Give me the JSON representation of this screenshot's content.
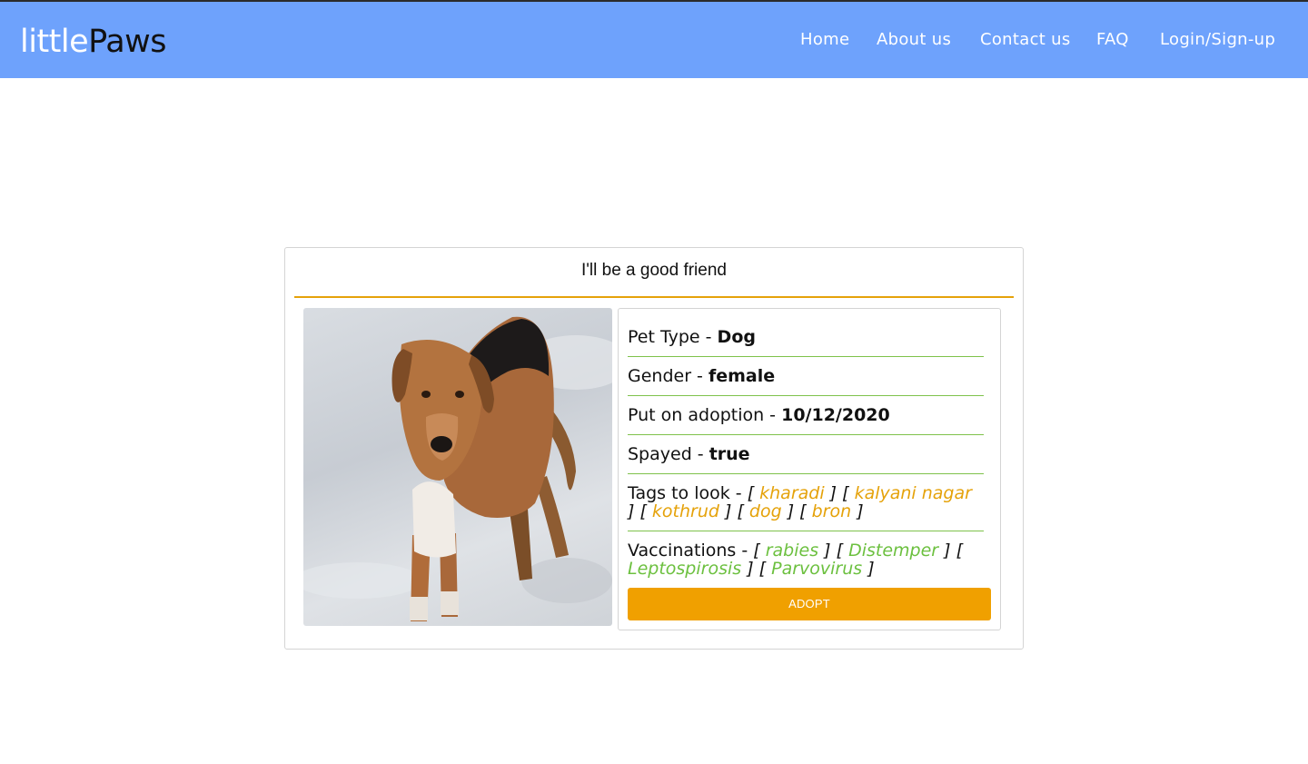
{
  "brand": {
    "light": "little",
    "dark": "Paws"
  },
  "nav": {
    "home": "Home",
    "about": "About us",
    "contact": "Contact us",
    "faq": "FAQ",
    "login": "Login/Sign-up"
  },
  "card": {
    "title": "I'll be a good friend",
    "pet_type": {
      "label": "Pet Type - ",
      "value": "Dog"
    },
    "gender": {
      "label": "Gender - ",
      "value": "female"
    },
    "adoption_date": {
      "label": "Put on adoption - ",
      "value": "10/12/2020"
    },
    "spayed": {
      "label": "Spayed - ",
      "value": "true"
    },
    "tags": {
      "label": "Tags to look - ",
      "items": [
        "kharadi",
        "kalyani nagar",
        "kothrud",
        "dog",
        "bron"
      ]
    },
    "vaccinations": {
      "label": "Vaccinations - ",
      "items": [
        "rabies",
        "Distemper",
        "Leptospirosis",
        "Parvovirus"
      ]
    },
    "adopt_button": "ADOPT"
  },
  "colors": {
    "navbar": "#6ea2fc",
    "accent_orange": "#f0a000",
    "vaccine_green": "#6cc03f"
  },
  "icons": {
    "pet_photo": "dog-photo"
  }
}
